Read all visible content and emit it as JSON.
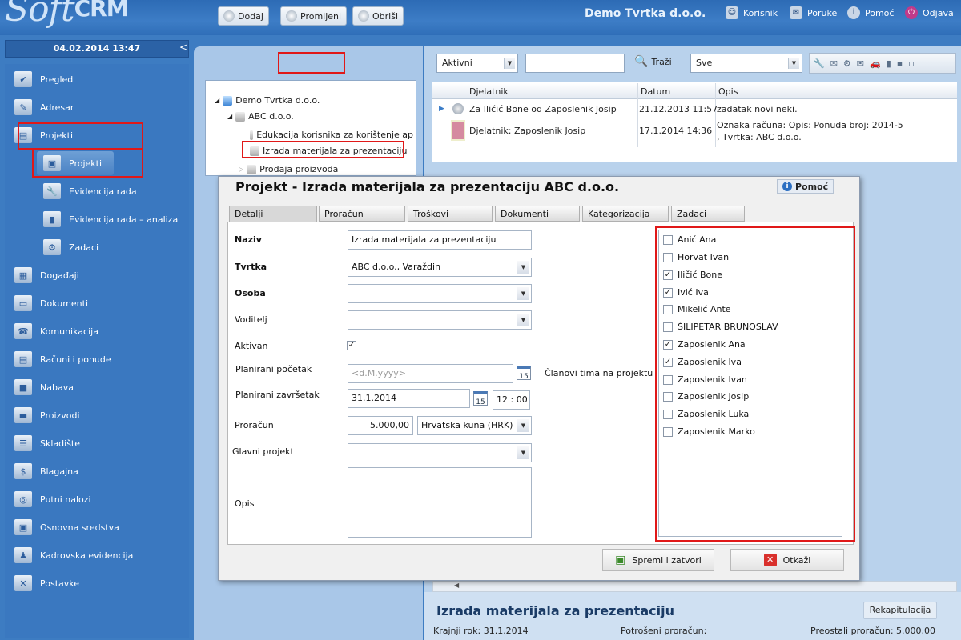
{
  "app": {
    "logo_soft": "Soft",
    "logo_crm": "CRM",
    "company": "Demo Tvrtka d.o.o."
  },
  "header_buttons": [
    {
      "label": "Korisnik",
      "icon": "user-icon"
    },
    {
      "label": "Poruke",
      "icon": "messages-icon"
    },
    {
      "label": "Pomoć",
      "icon": "info-icon"
    },
    {
      "label": "Odjava",
      "icon": "power-icon"
    }
  ],
  "datetime": "04.02.2014 13:47",
  "collapse_glyph": "<",
  "nav": {
    "pregled": "Pregled",
    "adresar": "Adresar",
    "projekti": "Projekti",
    "projekti_sub": "Projekti",
    "evidencija": "Evidencija rada",
    "evidencija_analiza": "Evidencija rada – analiza",
    "zadaci": "Zadaci",
    "dogadaji": "Događaji",
    "dokumenti": "Dokumenti",
    "komunikacija": "Komunikacija",
    "racuni": "Računi i ponude",
    "nabava": "Nabava",
    "proizvodi": "Proizvodi",
    "skladiste": "Skladište",
    "blagajna": "Blagajna",
    "putni": "Putni nalozi",
    "osnovna": "Osnovna sredstva",
    "kadrovska": "Kadrovska evidencija",
    "postavke": "Postavke"
  },
  "center_toolbar": {
    "add": "Dodaj",
    "edit": "Promijeni",
    "delete": "Obriši"
  },
  "tree": {
    "root": "Demo Tvrtka d.o.o.",
    "company": "ABC d.o.o.",
    "p1": "Edukacija korisnika za korištenje ap",
    "p2": "Izrada materijala za prezentaciju",
    "p3": "Prodaja proizvoda"
  },
  "right_toolbar": {
    "status": "Aktivni",
    "search_value": "",
    "search_button": "Traži",
    "filter": "Sve"
  },
  "grid": {
    "headers": {
      "djelatnik": "Djelatnik",
      "datum": "Datum",
      "opis": "Opis"
    },
    "rows": [
      {
        "djelatnik": "Za Iličić  Bone od Zaposlenik Josip",
        "datum": "21.12.2013 11:57",
        "opis": "zadatak novi neki."
      },
      {
        "djelatnik": "Djelatnik: Zaposlenik Josip",
        "datum": "17.1.2014 14:36",
        "opis": "Oznaka računa:   Opis: Ponuda broj: 2014-5",
        "opis2": ", Tvrtka: ABC d.o.o."
      }
    ]
  },
  "bottom": {
    "title": "Izrada materijala za prezentaciju",
    "rekap": "Rekapitulacija",
    "rok": "Krajnji rok: 31.1.2014",
    "potroseni": "Potrošeni proračun:",
    "preostali": "Preostali proračun: 5.000,00"
  },
  "dialog": {
    "title": "Projekt - Izrada materijala za prezentaciju ABC d.o.o.",
    "help": "Pomoć",
    "tabs": [
      "Detalji",
      "Proračun",
      "Troškovi",
      "Dokumenti",
      "Kategorizacija",
      "Zadaci"
    ],
    "labels": {
      "naziv": "Naziv",
      "tvrtka": "Tvrtka",
      "osoba": "Osoba",
      "voditelj": "Voditelj",
      "aktivan": "Aktivan",
      "poc": "Planirani početak",
      "zav": "Planirani završetak",
      "proracun": "Proračun",
      "glavni": "Glavni projekt",
      "opis": "Opis",
      "clanovi": "Članovi tima na projektu"
    },
    "values": {
      "naziv": "Izrada materijala za prezentaciju",
      "tvrtka": "ABC d.o.o., Varaždin",
      "osoba": "",
      "voditelj": "",
      "poc_placeholder": "<d.M.yyyy>",
      "zav": "31.1.2014",
      "zav_time": "12 : 00",
      "proracun": "5.000,00",
      "valuta": "Hrvatska kuna (HRK)",
      "glavni": "",
      "opis": "",
      "cal_day": "15"
    },
    "aktivan_checked": true,
    "members": [
      {
        "name": "Anić Ana",
        "checked": false
      },
      {
        "name": "Horvat Ivan",
        "checked": false
      },
      {
        "name": "Iličić  Bone",
        "checked": true
      },
      {
        "name": "Ivić Iva",
        "checked": true
      },
      {
        "name": "Mikelić Ante",
        "checked": false
      },
      {
        "name": "ŠILIPETAR BRUNOSLAV",
        "checked": false
      },
      {
        "name": "Zaposlenik Ana",
        "checked": true
      },
      {
        "name": "Zaposlenik Iva",
        "checked": true
      },
      {
        "name": "Zaposlenik Ivan",
        "checked": false
      },
      {
        "name": "Zaposlenik Josip",
        "checked": false
      },
      {
        "name": "Zaposlenik Luka",
        "checked": false
      },
      {
        "name": "Zaposlenik Marko",
        "checked": false
      }
    ],
    "save": "Spremi i zatvori",
    "cancel": "Otkaži"
  },
  "colors": {
    "highlight": "#e01818",
    "sidebar": "#3a78c0",
    "header": "#2d6bb5"
  }
}
